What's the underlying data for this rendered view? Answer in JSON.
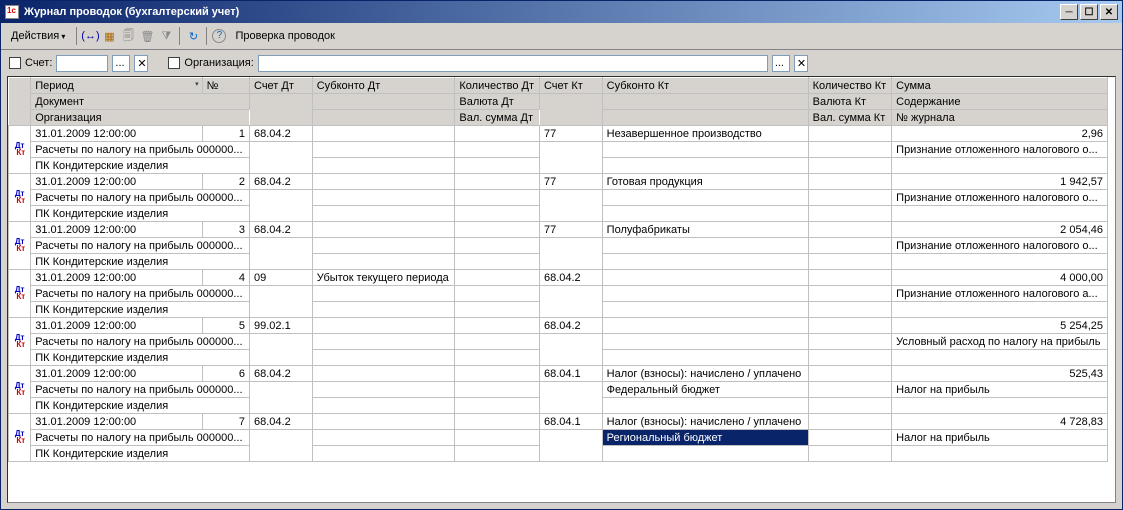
{
  "window": {
    "title": "Журнал проводок (бухгалтерский учет)"
  },
  "toolbar": {
    "actions": "Действия",
    "check": "Проверка проводок"
  },
  "filter": {
    "acct_label": "Счет:",
    "acct_value": "",
    "org_label": "Организация:",
    "org_value": ""
  },
  "headers": {
    "r1": {
      "period": "Период",
      "no": "№",
      "schdt": "Счет Дт",
      "subdt": "Субконто Дт",
      "koldt": "Количество Дт",
      "schkt": "Счет Кт",
      "subkt": "Субконто Кт",
      "kolkt": "Количество Кт",
      "summa": "Сумма"
    },
    "r2": {
      "doc": "Документ",
      "valdt": "Валюта Дт",
      "valkt": "Валюта Кт",
      "cont": "Содержание"
    },
    "r3": {
      "org": "Организация",
      "vsumdt": "Вал. сумма Дт",
      "vsumkt": "Вал. сумма Кт",
      "jrn": "№ журнала"
    }
  },
  "rows": [
    {
      "period": "31.01.2009 12:00:00",
      "no": "1",
      "schdt": "68.04.2",
      "subdt": "",
      "koldt": "",
      "schkt": "77",
      "subkt": "Незавершенное производство",
      "kolkt": "",
      "summa": "2,96",
      "doc": "Расчеты по налогу на прибыль 000000...",
      "valdt": "",
      "subdt2": "",
      "subkt2": "",
      "valkt": "",
      "cont": "Признание отложенного налогового о...",
      "org": "ПК Кондитерские изделия",
      "vsumdt": "",
      "subdt3": "",
      "subkt3": "",
      "vsumkt": "",
      "jrn": ""
    },
    {
      "period": "31.01.2009 12:00:00",
      "no": "2",
      "schdt": "68.04.2",
      "subdt": "",
      "koldt": "",
      "schkt": "77",
      "subkt": "Готовая продукция",
      "kolkt": "",
      "summa": "1 942,57",
      "doc": "Расчеты по налогу на прибыль 000000...",
      "valdt": "",
      "subdt2": "",
      "subkt2": "",
      "valkt": "",
      "cont": "Признание отложенного налогового о...",
      "org": "ПК Кондитерские изделия",
      "vsumdt": "",
      "subdt3": "",
      "subkt3": "",
      "vsumkt": "",
      "jrn": ""
    },
    {
      "period": "31.01.2009 12:00:00",
      "no": "3",
      "schdt": "68.04.2",
      "subdt": "",
      "koldt": "",
      "schkt": "77",
      "subkt": "Полуфабрикаты",
      "kolkt": "",
      "summa": "2 054,46",
      "doc": "Расчеты по налогу на прибыль 000000...",
      "valdt": "",
      "subdt2": "",
      "subkt2": "",
      "valkt": "",
      "cont": "Признание отложенного налогового о...",
      "org": "ПК Кондитерские изделия",
      "vsumdt": "",
      "subdt3": "",
      "subkt3": "",
      "vsumkt": "",
      "jrn": ""
    },
    {
      "period": "31.01.2009 12:00:00",
      "no": "4",
      "schdt": "09",
      "subdt": "Убыток текущего периода",
      "koldt": "",
      "schkt": "68.04.2",
      "subkt": "",
      "kolkt": "",
      "summa": "4 000,00",
      "doc": "Расчеты по налогу на прибыль 000000...",
      "valdt": "",
      "subdt2": "",
      "subkt2": "",
      "valkt": "",
      "cont": "Признание отложенного налогового а...",
      "org": "ПК Кондитерские изделия",
      "vsumdt": "",
      "subdt3": "",
      "subkt3": "",
      "vsumkt": "",
      "jrn": ""
    },
    {
      "period": "31.01.2009 12:00:00",
      "no": "5",
      "schdt": "99.02.1",
      "subdt": "",
      "koldt": "",
      "schkt": "68.04.2",
      "subkt": "",
      "kolkt": "",
      "summa": "5 254,25",
      "doc": "Расчеты по налогу на прибыль 000000...",
      "valdt": "",
      "subdt2": "",
      "subkt2": "",
      "valkt": "",
      "cont": "Условный расход по налогу на прибыль",
      "org": "ПК Кондитерские изделия",
      "vsumdt": "",
      "subdt3": "",
      "subkt3": "",
      "vsumkt": "",
      "jrn": ""
    },
    {
      "period": "31.01.2009 12:00:00",
      "no": "6",
      "schdt": "68.04.2",
      "subdt": "",
      "koldt": "",
      "schkt": "68.04.1",
      "subkt": "Налог (взносы): начислено / уплачено",
      "kolkt": "",
      "summa": "525,43",
      "doc": "Расчеты по налогу на прибыль 000000...",
      "valdt": "",
      "subdt2": "",
      "subkt2": "Федеральный бюджет",
      "valkt": "",
      "cont": "Налог на прибыль",
      "org": "ПК Кондитерские изделия",
      "vsumdt": "",
      "subdt3": "",
      "subkt3": "",
      "vsumkt": "",
      "jrn": ""
    },
    {
      "period": "31.01.2009 12:00:00",
      "no": "7",
      "schdt": "68.04.2",
      "subdt": "",
      "koldt": "",
      "schkt": "68.04.1",
      "subkt": "Налог (взносы): начислено / уплачено",
      "kolkt": "",
      "summa": "4 728,83",
      "doc": "Расчеты по налогу на прибыль 000000...",
      "valdt": "",
      "subdt2": "",
      "subkt2": "Региональный бюджет",
      "valkt": "",
      "cont": "Налог на прибыль",
      "org": "ПК Кондитерские изделия",
      "vsumdt": "",
      "subdt3": "",
      "subkt3": "",
      "vsumkt": "",
      "jrn": "",
      "sel": true
    }
  ]
}
